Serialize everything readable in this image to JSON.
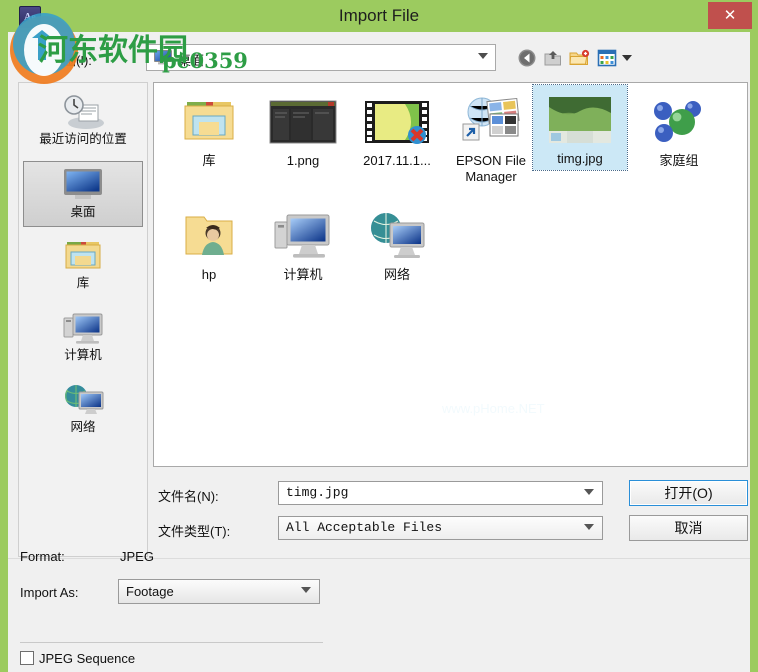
{
  "window": {
    "title": "Import File",
    "close_label": "✕",
    "app_icon": "Ae",
    "titlebar_color": "#9ccb5f",
    "close_color": "#c0504d"
  },
  "lookin": {
    "label": "查找范围(I):",
    "value": "桌面",
    "icon": "desktop-icon"
  },
  "toolbar": {
    "back": "back-icon",
    "up": "up-folder-icon",
    "new_folder": "new-folder-icon",
    "views": "views-icon"
  },
  "places": [
    {
      "label": "最近访问的位置",
      "icon": "recent-places-icon",
      "selected": false
    },
    {
      "label": "桌面",
      "icon": "desktop-icon",
      "selected": true
    },
    {
      "label": "库",
      "icon": "library-icon",
      "selected": false
    },
    {
      "label": "计算机",
      "icon": "computer-icon",
      "selected": false
    },
    {
      "label": "网络",
      "icon": "network-icon",
      "selected": false
    }
  ],
  "files": [
    {
      "name": "库",
      "icon": "library-folder-icon",
      "selected": false
    },
    {
      "name": "1.png",
      "icon": "png-thumb-icon",
      "selected": false
    },
    {
      "name": "2017.11.1...",
      "icon": "video-thumb-icon",
      "selected": false
    },
    {
      "name": "EPSON File Manager",
      "icon": "epson-shortcut-icon",
      "selected": false
    },
    {
      "name": "timg.jpg",
      "icon": "jpg-thumb-icon",
      "selected": true
    },
    {
      "name": "家庭组",
      "icon": "homegroup-icon",
      "selected": false
    },
    {
      "name": "hp",
      "icon": "user-folder-icon",
      "selected": false
    },
    {
      "name": "计算机",
      "icon": "computer-icon",
      "selected": false
    },
    {
      "name": "网络",
      "icon": "network-icon",
      "selected": false
    }
  ],
  "form": {
    "name_label": "文件名(N):",
    "name_value": "timg.jpg",
    "type_label": "文件类型(T):",
    "type_value": "All Acceptable Files",
    "open_button": "打开(O)",
    "cancel_button": "取消"
  },
  "import_options": {
    "format_label": "Format:",
    "format_value": "JPEG",
    "import_as_label": "Import As:",
    "import_as_value": "Footage",
    "sequence_label": "JPEG Sequence",
    "sequence_checked": false
  },
  "watermark": {
    "main": "河东软件园",
    "sub": "pc0359",
    "faint": "www.pHome.NET"
  }
}
